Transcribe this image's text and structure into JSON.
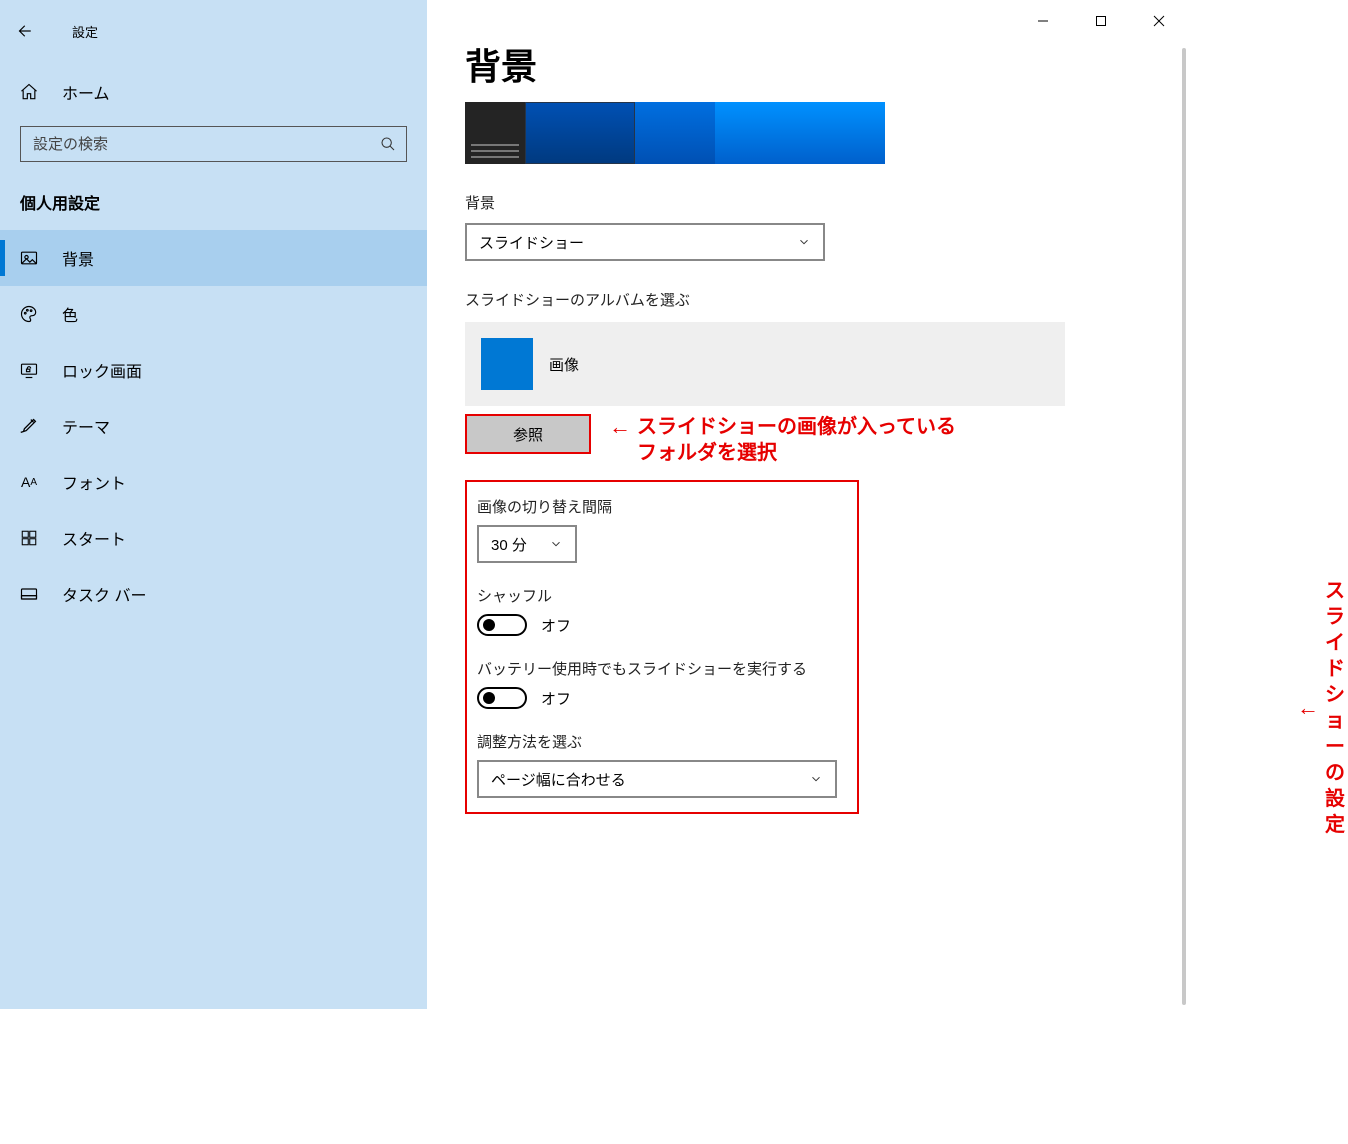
{
  "window": {
    "title": "設定"
  },
  "sidebar": {
    "home": "ホーム",
    "search_placeholder": "設定の検索",
    "category": "個人用設定",
    "items": [
      {
        "label": "背景",
        "active": true
      },
      {
        "label": "色"
      },
      {
        "label": "ロック画面"
      },
      {
        "label": "テーマ"
      },
      {
        "label": "フォント"
      },
      {
        "label": "スタート"
      },
      {
        "label": "タスク バー"
      }
    ]
  },
  "main": {
    "title": "背景",
    "background_label": "背景",
    "background_value": "スライドショー",
    "album_label": "スライドショーのアルバムを選ぶ",
    "album_name": "画像",
    "browse_button": "参照",
    "interval_label": "画像の切り替え間隔",
    "interval_value": "30 分",
    "shuffle_label": "シャッフル",
    "shuffle_value": "オフ",
    "battery_label": "バッテリー使用時でもスライドショーを実行する",
    "battery_value": "オフ",
    "fit_label": "調整方法を選ぶ",
    "fit_value": "ページ幅に合わせる"
  },
  "callouts": {
    "browse_line1": "スライドショーの画像が入っている",
    "browse_line2": "フォルダを選択",
    "settings": "スライドショーの設定"
  }
}
